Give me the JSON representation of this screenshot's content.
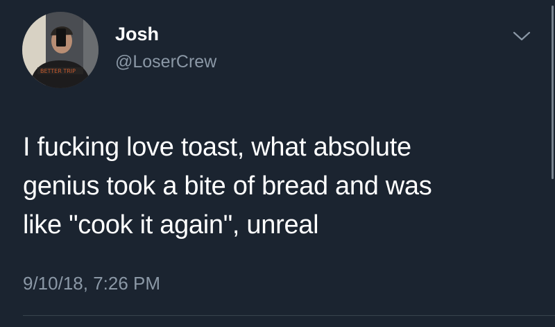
{
  "author": {
    "display_name": "Josh",
    "handle": "@LoserCrew",
    "avatar_shirt_text": "BETTER TRIP"
  },
  "tweet": {
    "lines": [
      "I fucking love toast, what absolute",
      "genius took a bite of bread and was",
      "like \"cook it again\", unreal"
    ],
    "timestamp": "9/10/18, 7:26 PM"
  },
  "icons": {
    "menu": "chevron-down-icon",
    "avatar": "profile-photo"
  },
  "colors": {
    "background": "#1b2430",
    "primary_text": "#ffffff",
    "secondary_text": "#8b98a6",
    "divider": "#38444d"
  }
}
